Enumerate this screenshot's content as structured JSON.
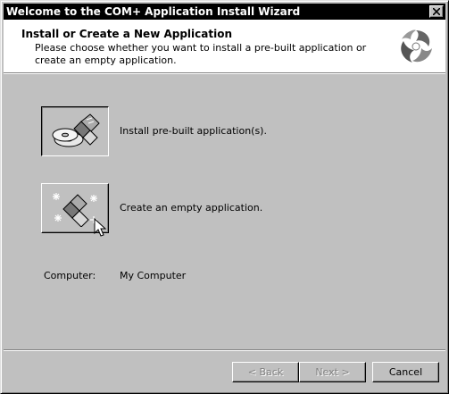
{
  "window": {
    "title": "Welcome to the COM+ Application Install Wizard"
  },
  "header": {
    "heading": "Install or Create a New Application",
    "subtitle": "Please choose whether you want to install a pre-built application or create an empty application.",
    "logo_icon": "wizard-swirl-icon"
  },
  "options": [
    {
      "label": "Install pre-built application(s).",
      "icon": "cd-package-icon",
      "pressed": true
    },
    {
      "label": "Create an empty application.",
      "icon": "sparkle-package-icon",
      "pressed": false
    }
  ],
  "info": {
    "computer_label": "Computer:",
    "computer_value": "My Computer"
  },
  "buttons": {
    "back": {
      "label": "< Back",
      "enabled": false
    },
    "next": {
      "label": "Next >",
      "enabled": false
    },
    "cancel": {
      "label": "Cancel",
      "enabled": true
    }
  },
  "colors": {
    "face": "#c0c0c0",
    "titlebar": "#000000",
    "header_bg": "#ffffff",
    "disabled_text": "#808080"
  }
}
